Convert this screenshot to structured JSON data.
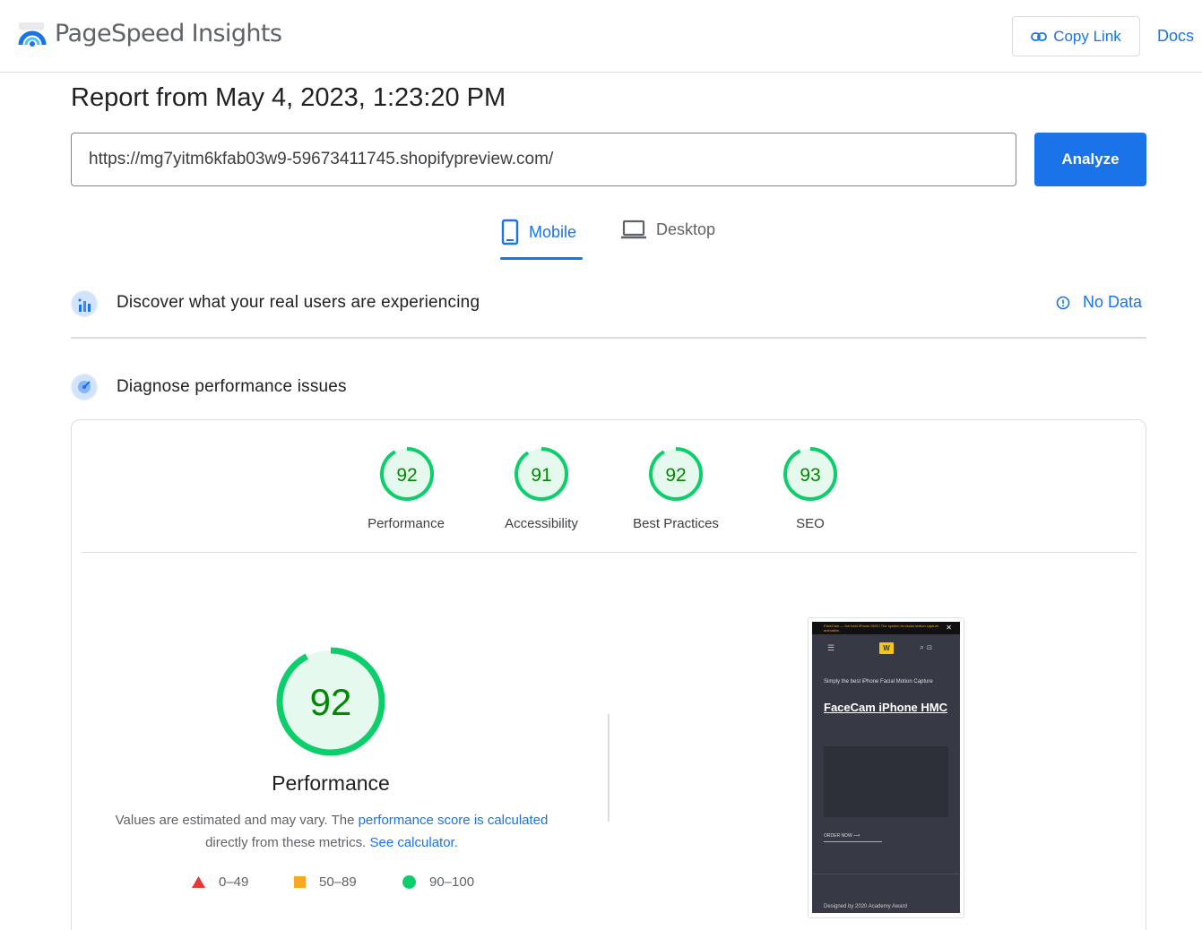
{
  "header": {
    "brand": "PageSpeed Insights",
    "copy_link_label": "Copy Link",
    "docs_label": "Docs"
  },
  "report": {
    "title": "Report from May 4, 2023, 1:23:20 PM",
    "url_value": "https://mg7yitm6kfab03w9-59673411745.shopifypreview.com/",
    "analyze_label": "Analyze"
  },
  "tabs": [
    {
      "label": "Mobile",
      "icon": "smartphone-icon",
      "active": true
    },
    {
      "label": "Desktop",
      "icon": "laptop-icon",
      "active": false
    }
  ],
  "field_data": {
    "title": "Discover what your real users are experiencing",
    "status": "No Data"
  },
  "diagnose": {
    "title": "Diagnose performance issues"
  },
  "scores": [
    {
      "label": "Performance",
      "value": "92"
    },
    {
      "label": "Accessibility",
      "value": "91"
    },
    {
      "label": "Best Practices",
      "value": "92"
    },
    {
      "label": "SEO",
      "value": "93"
    }
  ],
  "main_score": {
    "value": "92",
    "label": "Performance",
    "desc_prefix": "Values are estimated and may vary. The ",
    "desc_link1": "performance score is calculated",
    "desc_middle": "directly from these metrics. ",
    "desc_link2": "See calculator."
  },
  "legend": [
    {
      "range": "0–49",
      "shape": "triangle",
      "color": "#e53935"
    },
    {
      "range": "50–89",
      "shape": "square",
      "color": "#f9a825"
    },
    {
      "range": "90–100",
      "shape": "circle",
      "color": "#0cce6b"
    }
  ],
  "colors": {
    "accent": "#1a73e8",
    "pass_ring": "#0cce6b",
    "pass_text": "#008800",
    "pass_fill": "#e6f9ee"
  },
  "screenshot": {
    "announcement": "FaceCam — the best iPhone HMC! The system for facial motion capture animation",
    "tagline": "Simply the best iPhone Facial Motion Capture",
    "heading": "FaceCam iPhone HMC",
    "cta": "ORDER NOW",
    "footer": "Designed by 2020 Academy Award"
  }
}
